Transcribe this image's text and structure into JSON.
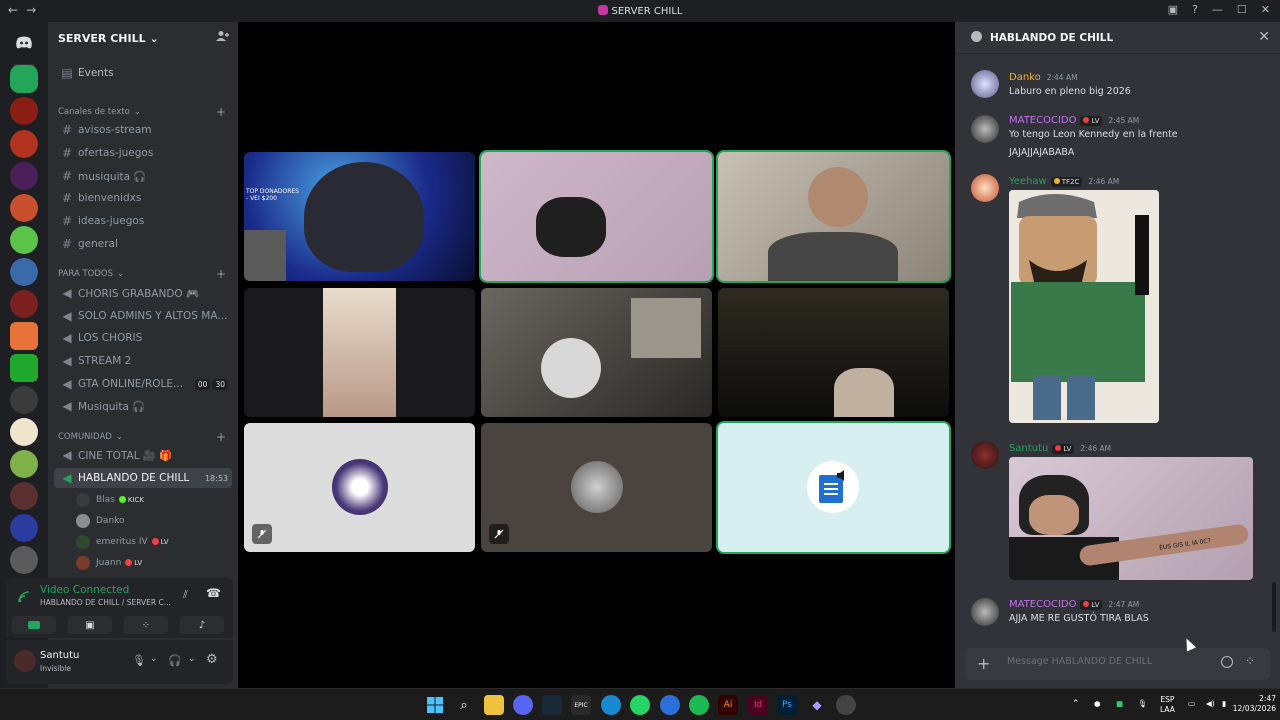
{
  "window": {
    "title": "SERVER CHILL"
  },
  "server": {
    "name": "SERVER CHILL"
  },
  "events": {
    "label": "Events"
  },
  "categories": {
    "text": "Canales de texto",
    "todos": "PARA TODOS",
    "comunidad": "COMUNIDAD"
  },
  "text_channels": [
    "avisos-stream",
    "ofertas-juegos",
    "musiquita 🎧",
    "bienvenidxs",
    "ideas-juegos",
    "general"
  ],
  "voice_channels_todos": [
    "CHORIS GRABANDO 🎮",
    "SOLO ADMINS Y ALTOS MA...",
    "LOS CHORIS",
    "STREAM 2",
    "GTA ONLINE/ROLE...",
    "Musiquita 🎧"
  ],
  "gta_counts": [
    "00",
    "30"
  ],
  "voice_channels_comunidad": [
    "CINE TOTAL 🎥 🎁",
    "HABLANDO DE CHILL"
  ],
  "active_voice_time": "18:53",
  "voice_members": [
    {
      "name": "Blas",
      "tag": "KICK"
    },
    {
      "name": "Danko",
      "tag": ""
    },
    {
      "name": "emeritus IV",
      "tag": "LV"
    },
    {
      "name": "Juann",
      "tag": "LV"
    }
  ],
  "voice_status": {
    "title": "Video Connected",
    "subtitle": "HABLANDO DE CHILL / SERVER C..."
  },
  "user": {
    "name": "Santutu",
    "status": "Invisible"
  },
  "chat": {
    "title": "HABLANDO DE CHILL",
    "input_placeholder": "Message HABLANDO DE CHILL",
    "messages": [
      {
        "author": "Danko",
        "time": "2:44 AM",
        "tag": "",
        "text": "Laburo en pleno big 2026",
        "color": "#f0b232"
      },
      {
        "author": "MATECOCIDO",
        "time": "2:45 AM",
        "tag": "LV",
        "text": "Yo tengo Leon Kennedy en la frente",
        "text2": "JAJAJJAJABABA",
        "color": "#c372f0"
      },
      {
        "author": "Yeehaw",
        "time": "2:46 AM",
        "tag": "TF2C",
        "text": "",
        "color": "#23a55a"
      },
      {
        "author": "Santutu",
        "time": "2:46 AM",
        "tag": "LV",
        "text": "",
        "color": "#23a55a"
      },
      {
        "author": "MATECOCIDO",
        "time": "2:47 AM",
        "tag": "LV",
        "text": "AJJA ME RE GUSTÓ TIRA BLAS",
        "color": "#c372f0"
      }
    ],
    "image_caption": "ÉUS GIS IL IA 0C?"
  },
  "stream_overlay": {
    "line1": "TOP DONADORES",
    "line2": "- VEI $200"
  },
  "taskbar": {
    "lang": "ESP",
    "layout": "LAA",
    "time": "2:47",
    "date": "12/03/2026"
  },
  "colors": {
    "speaking": "#23a55a",
    "accent": "#5865f2",
    "danger": "#f23f43"
  }
}
